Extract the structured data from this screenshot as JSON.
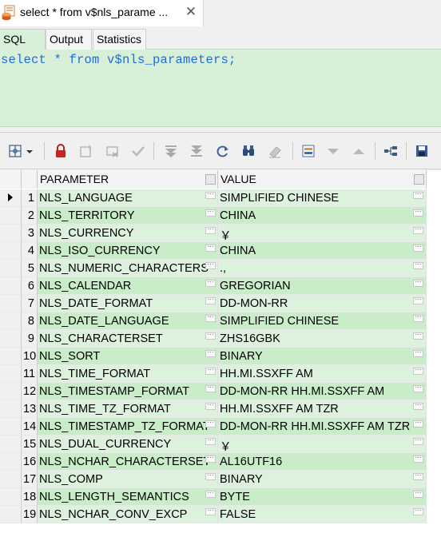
{
  "document_tab": {
    "title": "select * from v$nls_parame ...",
    "close_glyph": "✕"
  },
  "sub_tabs": [
    {
      "label": "SQL",
      "active": true
    },
    {
      "label": "Output",
      "active": false
    },
    {
      "label": "Statistics",
      "active": false
    }
  ],
  "editor": {
    "sql": "select * from v$nls_parameters;"
  },
  "toolbar_icons": [
    "grid-view-icon",
    "dropdown-arrow-icon",
    "lock-icon",
    "insert-record-icon",
    "delete-record-icon",
    "post-edit-icon",
    "first-record-icon",
    "last-record-icon",
    "refresh-icon",
    "find-icon",
    "clear-icon",
    "single-record-view-icon",
    "sort-descending-icon",
    "sort-ascending-icon",
    "query-plan-icon",
    "save-icon"
  ],
  "grid": {
    "columns": [
      "PARAMETER",
      "VALUE"
    ],
    "current_row": 1,
    "rows": [
      {
        "n": "1",
        "parameter": "NLS_LANGUAGE",
        "value": "SIMPLIFIED CHINESE"
      },
      {
        "n": "2",
        "parameter": "NLS_TERRITORY",
        "value": "CHINA"
      },
      {
        "n": "3",
        "parameter": "NLS_CURRENCY",
        "value": "￥"
      },
      {
        "n": "4",
        "parameter": "NLS_ISO_CURRENCY",
        "value": "CHINA"
      },
      {
        "n": "5",
        "parameter": "NLS_NUMERIC_CHARACTERS",
        "value": ".,"
      },
      {
        "n": "6",
        "parameter": "NLS_CALENDAR",
        "value": "GREGORIAN"
      },
      {
        "n": "7",
        "parameter": "NLS_DATE_FORMAT",
        "value": "DD-MON-RR"
      },
      {
        "n": "8",
        "parameter": "NLS_DATE_LANGUAGE",
        "value": "SIMPLIFIED CHINESE"
      },
      {
        "n": "9",
        "parameter": "NLS_CHARACTERSET",
        "value": "ZHS16GBK"
      },
      {
        "n": "10",
        "parameter": "NLS_SORT",
        "value": "BINARY"
      },
      {
        "n": "11",
        "parameter": "NLS_TIME_FORMAT",
        "value": "HH.MI.SSXFF AM"
      },
      {
        "n": "12",
        "parameter": "NLS_TIMESTAMP_FORMAT",
        "value": "DD-MON-RR HH.MI.SSXFF AM"
      },
      {
        "n": "13",
        "parameter": "NLS_TIME_TZ_FORMAT",
        "value": "HH.MI.SSXFF AM TZR"
      },
      {
        "n": "14",
        "parameter": "NLS_TIMESTAMP_TZ_FORMAT",
        "value": "DD-MON-RR HH.MI.SSXFF AM TZR"
      },
      {
        "n": "15",
        "parameter": "NLS_DUAL_CURRENCY",
        "value": "￥"
      },
      {
        "n": "16",
        "parameter": "NLS_NCHAR_CHARACTERSET",
        "value": "AL16UTF16"
      },
      {
        "n": "17",
        "parameter": "NLS_COMP",
        "value": "BINARY"
      },
      {
        "n": "18",
        "parameter": "NLS_LENGTH_SEMANTICS",
        "value": "BYTE"
      },
      {
        "n": "19",
        "parameter": "NLS_NCHAR_CONV_EXCP",
        "value": "FALSE"
      }
    ]
  },
  "colors": {
    "editor_bg": "#d8f0d8",
    "keyword": "#1f6bd8",
    "row_light": "#ddf2dd",
    "row_dark": "#c9ecc9"
  }
}
